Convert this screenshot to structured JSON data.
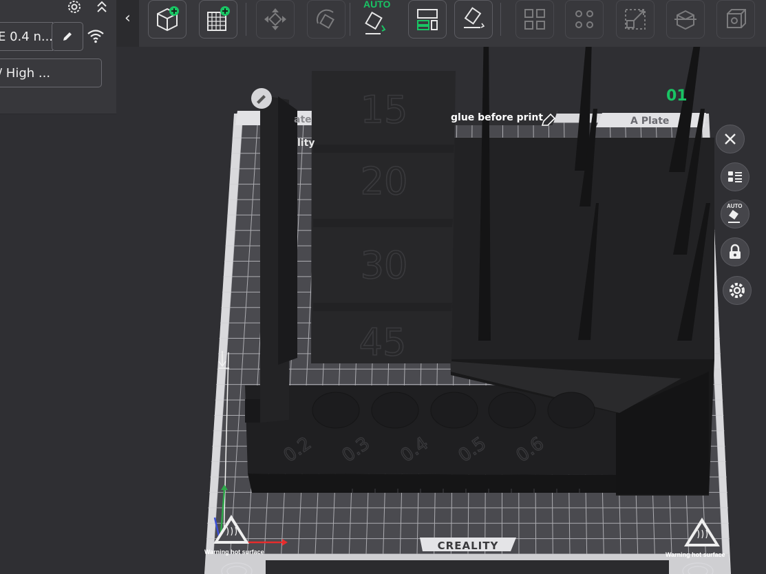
{
  "left_panel": {
    "nozzle_value": "E 0.4 n...",
    "quality_value": "/ High ..."
  },
  "toolbar": {
    "collapse_glyph": "‹",
    "auto_arrange_badge": "AUTO",
    "buttons": [
      {
        "icon": "add-model-icon"
      },
      {
        "icon": "add-plate-icon"
      },
      {
        "icon": "move-icon"
      },
      {
        "icon": "rotate-icon"
      },
      {
        "icon": "auto-orient-icon"
      },
      {
        "icon": "arrange-icon"
      },
      {
        "icon": "lay-on-face-icon"
      },
      {
        "icon": "split-icon"
      },
      {
        "icon": "support-paint-icon"
      },
      {
        "icon": "scale-icon"
      },
      {
        "icon": "cut-icon"
      },
      {
        "icon": "box-view-icon"
      }
    ]
  },
  "plate": {
    "left_label": "ate",
    "note_label": "glue before print",
    "right_label": "A Plate",
    "counter": "01",
    "partial_name": "lity",
    "brand": "CREALITY",
    "warning_left": "Warning hot surface",
    "warning_right": "Warning hot surface"
  },
  "model": {
    "tower_labels": [
      "15",
      "20",
      "30",
      "45"
    ],
    "nozzle_labels": [
      "0.2",
      "0.3",
      "0.4",
      "0.5",
      "0.6"
    ]
  },
  "right_controls": {
    "auto_badge": "AUTO",
    "items": [
      "close-icon",
      "list-icon",
      "auto-paint-icon",
      "lock-icon",
      "settings-icon"
    ]
  },
  "colors": {
    "accent": "#19c464",
    "background": "#2f2f33",
    "panel": "#37373b",
    "bed_grid": "#e9e9ec",
    "model": "#1d1d1f"
  }
}
